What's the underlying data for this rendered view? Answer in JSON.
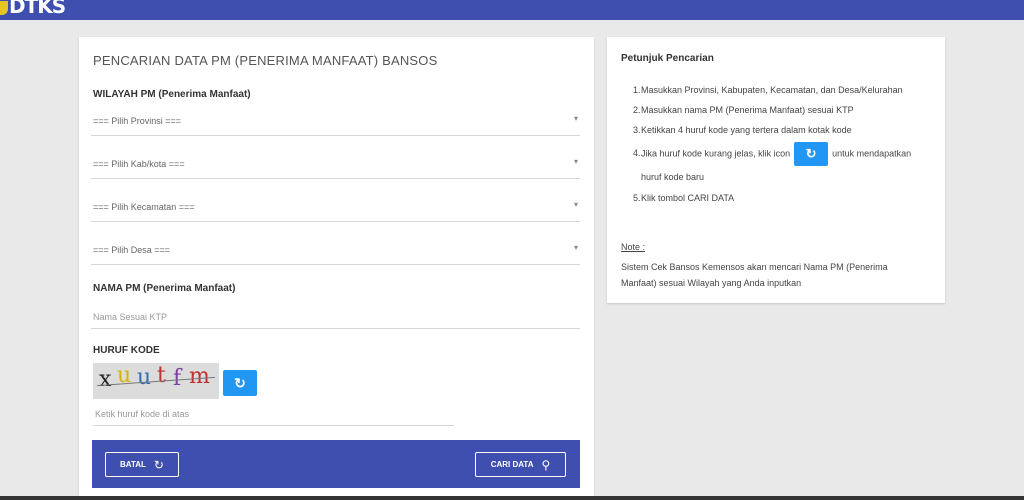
{
  "header": {
    "logo_text": "DTKS"
  },
  "search_form": {
    "title": "PENCARIAN DATA PM (PENERIMA MANFAAT) BANSOS",
    "wilayah_label": "WILAYAH PM (Penerima Manfaat)",
    "selects": [
      {
        "value": "=== Pilih Provinsi ==="
      },
      {
        "value": "=== Pilih Kab/kota ==="
      },
      {
        "value": "=== Pilih Kecamatan ==="
      },
      {
        "value": "=== Pilih Desa ==="
      }
    ],
    "nama_label": "NAMA PM (Penerima Manfaat)",
    "nama_placeholder": "Nama Sesuai KTP",
    "kode_label": "HURUF KODE",
    "captcha_chars": [
      "x",
      "u",
      "u",
      "t",
      "f",
      "m"
    ],
    "kode_placeholder": "Ketik huruf kode di atas",
    "batal_label": "BATAL",
    "cari_label": "CARI DATA"
  },
  "hints": {
    "title": "Petunjuk Pencarian",
    "steps": [
      {
        "num": "1.",
        "text": "Masukkan Provinsi, Kabupaten, Kecamatan, dan Desa/Kelurahan"
      },
      {
        "num": "2.",
        "text": "Masukkan nama PM (Penerima Manfaat) sesuai KTP"
      },
      {
        "num": "3.",
        "text": "Ketikkan 4 huruf kode yang tertera dalam kotak kode"
      },
      {
        "num": "4.",
        "text_before": "Jika huruf kode kurang jelas, klik icon",
        "text_after": "untuk mendapatkan huruf kode baru"
      },
      {
        "num": "5.",
        "text": "Klik tombol CARI DATA"
      }
    ],
    "note_title": "Note :",
    "note_text": "Sistem Cek Bansos Kemensos akan mencari Nama PM (Penerima Manfaat) sesuai Wilayah yang Anda inputkan"
  },
  "colors": {
    "primary": "#3f4fb0",
    "accent": "#2196f3",
    "background": "#e9e9e9"
  },
  "icons": {
    "refresh": "refresh-icon",
    "search": "search-icon",
    "dropdown": "chevron-down-icon"
  }
}
